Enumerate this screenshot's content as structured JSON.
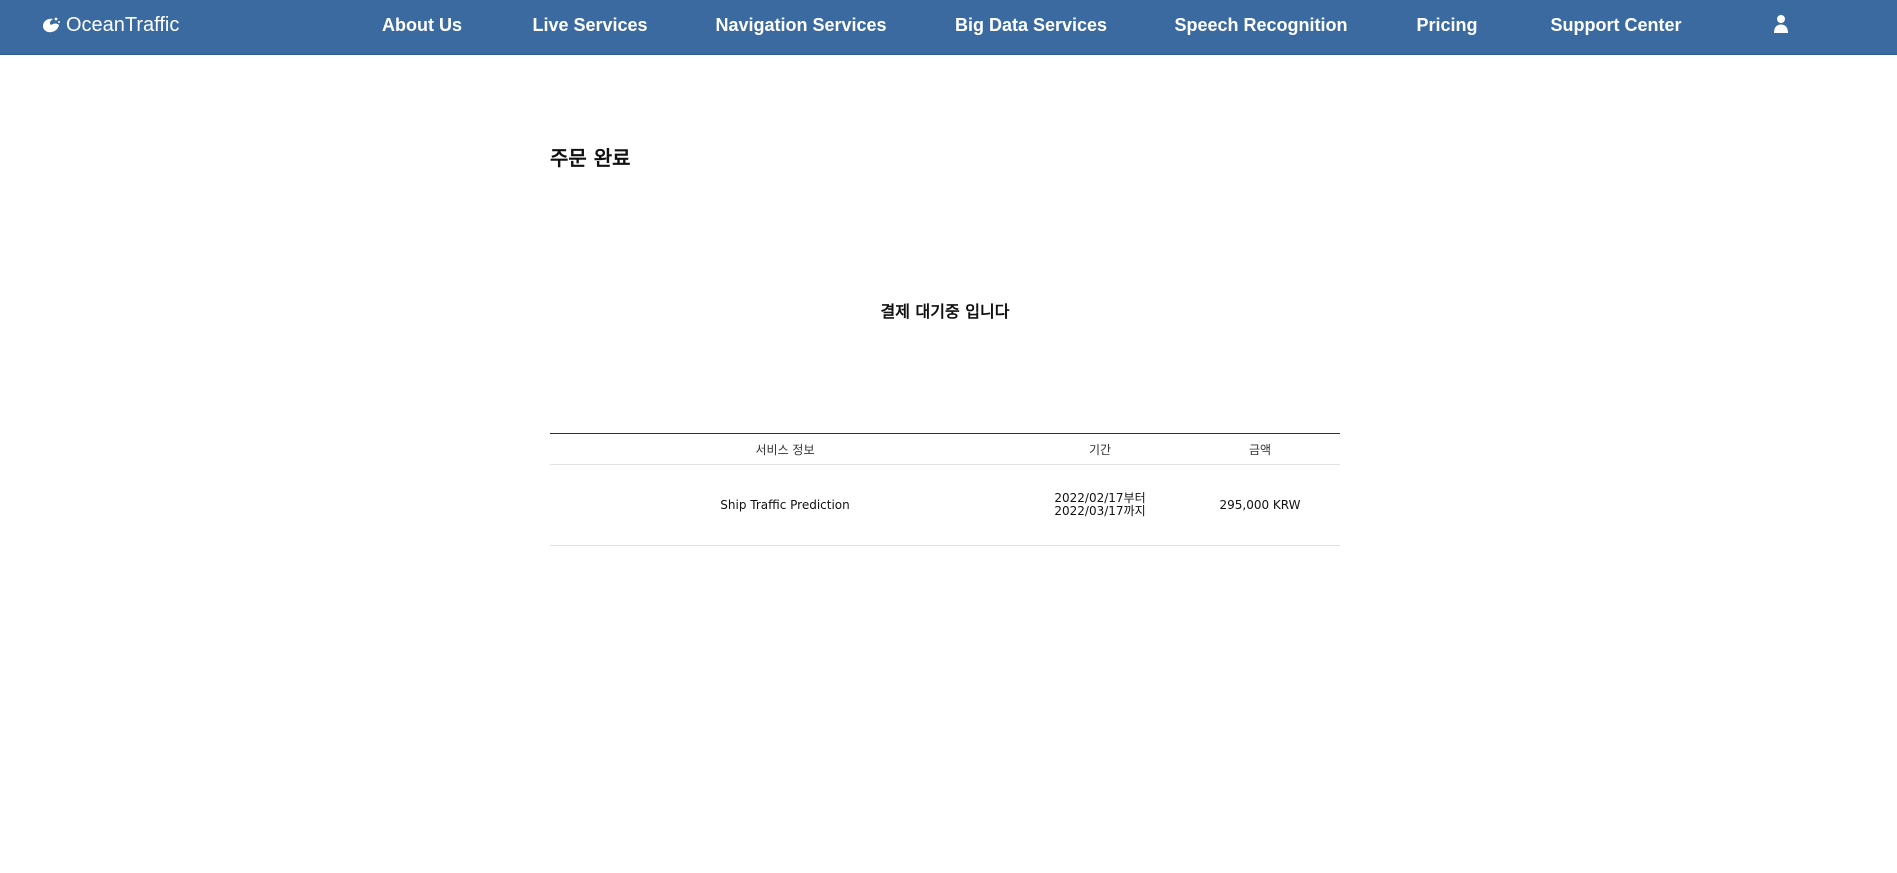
{
  "header": {
    "logo_text": "OceanTraffic",
    "nav": [
      {
        "label": "About Us"
      },
      {
        "label": "Live Services"
      },
      {
        "label": "Navigation Services"
      },
      {
        "label": "Big Data Services"
      },
      {
        "label": "Speech Recognition"
      },
      {
        "label": "Pricing"
      },
      {
        "label": "Support Center"
      }
    ],
    "user_icon": "user-icon",
    "background_color": "#3a6aa0"
  },
  "main": {
    "title": "주문 완료",
    "status_message": "결제 대기중 입니다",
    "table": {
      "columns": [
        "서비스 정보",
        "기간",
        "금액"
      ],
      "rows": [
        {
          "service": "Ship Traffic Prediction",
          "period_start": "2022/02/17부터",
          "period_end": "2022/03/17까지",
          "amount": "295,000 KRW"
        }
      ]
    }
  }
}
